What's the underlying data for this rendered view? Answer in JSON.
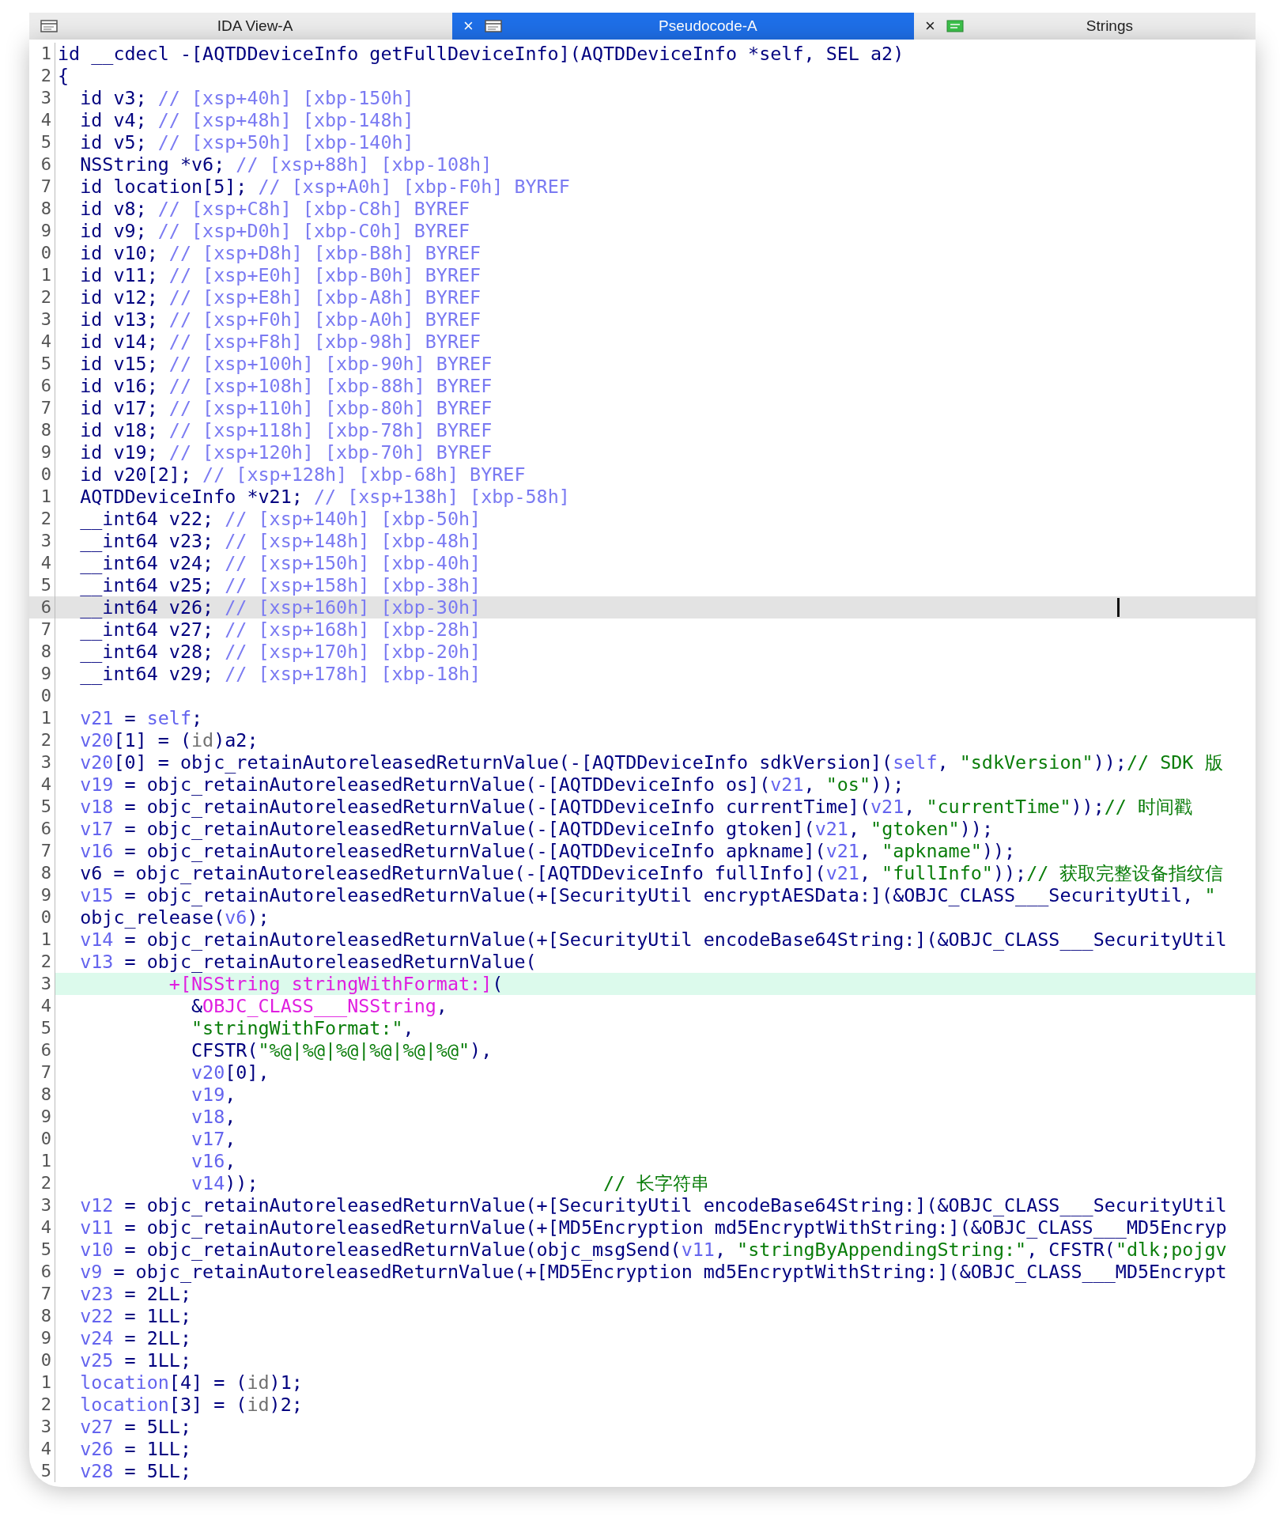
{
  "tabs": [
    {
      "label": "IDA View-A",
      "selected": false
    },
    {
      "label": "Pseudocode-A",
      "selected": true
    },
    {
      "label": "Strings",
      "selected": false
    }
  ],
  "tab_close": [
    "×",
    "×"
  ],
  "lines": [
    {
      "number": "1",
      "selected": false,
      "highlighted": false,
      "tokens": [
        {
          "kind": "plain",
          "text": "id __cdecl -[AQTDDeviceInfo getFullDeviceInfo](AQTDDeviceInfo *self, SEL a2)"
        }
      ]
    },
    {
      "number": "2",
      "selected": false,
      "highlighted": false,
      "tokens": [
        {
          "kind": "plain",
          "text": "{"
        }
      ]
    },
    {
      "number": "3",
      "selected": false,
      "highlighted": false,
      "tokens": [
        {
          "kind": "plain",
          "text": "  id v3; "
        },
        {
          "kind": "note",
          "text": "// [xsp+40h] [xbp-150h]"
        }
      ]
    },
    {
      "number": "4",
      "selected": false,
      "highlighted": false,
      "tokens": [
        {
          "kind": "plain",
          "text": "  id v4; "
        },
        {
          "kind": "note",
          "text": "// [xsp+48h] [xbp-148h]"
        }
      ]
    },
    {
      "number": "5",
      "selected": false,
      "highlighted": false,
      "tokens": [
        {
          "kind": "plain",
          "text": "  id v5; "
        },
        {
          "kind": "note",
          "text": "// [xsp+50h] [xbp-140h]"
        }
      ]
    },
    {
      "number": "6",
      "selected": false,
      "highlighted": false,
      "tokens": [
        {
          "kind": "plain",
          "text": "  NSString *v6; "
        },
        {
          "kind": "note",
          "text": "// [xsp+88h] [xbp-108h]"
        }
      ]
    },
    {
      "number": "7",
      "selected": false,
      "highlighted": false,
      "tokens": [
        {
          "kind": "plain",
          "text": "  id location[5]; "
        },
        {
          "kind": "note",
          "text": "// [xsp+A0h] [xbp-F0h] BYREF"
        }
      ]
    },
    {
      "number": "8",
      "selected": false,
      "highlighted": false,
      "tokens": [
        {
          "kind": "plain",
          "text": "  id v8; "
        },
        {
          "kind": "note",
          "text": "// [xsp+C8h] [xbp-C8h] BYREF"
        }
      ]
    },
    {
      "number": "9",
      "selected": false,
      "highlighted": false,
      "tokens": [
        {
          "kind": "plain",
          "text": "  id v9; "
        },
        {
          "kind": "note",
          "text": "// [xsp+D0h] [xbp-C0h] BYREF"
        }
      ]
    },
    {
      "number": "0",
      "selected": false,
      "highlighted": false,
      "tokens": [
        {
          "kind": "plain",
          "text": "  id v10; "
        },
        {
          "kind": "note",
          "text": "// [xsp+D8h] [xbp-B8h] BYREF"
        }
      ]
    },
    {
      "number": "1",
      "selected": false,
      "highlighted": false,
      "tokens": [
        {
          "kind": "plain",
          "text": "  id v11; "
        },
        {
          "kind": "note",
          "text": "// [xsp+E0h] [xbp-B0h] BYREF"
        }
      ]
    },
    {
      "number": "2",
      "selected": false,
      "highlighted": false,
      "tokens": [
        {
          "kind": "plain",
          "text": "  id v12; "
        },
        {
          "kind": "note",
          "text": "// [xsp+E8h] [xbp-A8h] BYREF"
        }
      ]
    },
    {
      "number": "3",
      "selected": false,
      "highlighted": false,
      "tokens": [
        {
          "kind": "plain",
          "text": "  id v13; "
        },
        {
          "kind": "note",
          "text": "// [xsp+F0h] [xbp-A0h] BYREF"
        }
      ]
    },
    {
      "number": "4",
      "selected": false,
      "highlighted": false,
      "tokens": [
        {
          "kind": "plain",
          "text": "  id v14; "
        },
        {
          "kind": "note",
          "text": "// [xsp+F8h] [xbp-98h] BYREF"
        }
      ]
    },
    {
      "number": "5",
      "selected": false,
      "highlighted": false,
      "tokens": [
        {
          "kind": "plain",
          "text": "  id v15; "
        },
        {
          "kind": "note",
          "text": "// [xsp+100h] [xbp-90h] BYREF"
        }
      ]
    },
    {
      "number": "6",
      "selected": false,
      "highlighted": false,
      "tokens": [
        {
          "kind": "plain",
          "text": "  id v16; "
        },
        {
          "kind": "note",
          "text": "// [xsp+108h] [xbp-88h] BYREF"
        }
      ]
    },
    {
      "number": "7",
      "selected": false,
      "highlighted": false,
      "tokens": [
        {
          "kind": "plain",
          "text": "  id v17; "
        },
        {
          "kind": "note",
          "text": "// [xsp+110h] [xbp-80h] BYREF"
        }
      ]
    },
    {
      "number": "8",
      "selected": false,
      "highlighted": false,
      "tokens": [
        {
          "kind": "plain",
          "text": "  id v18; "
        },
        {
          "kind": "note",
          "text": "// [xsp+118h] [xbp-78h] BYREF"
        }
      ]
    },
    {
      "number": "9",
      "selected": false,
      "highlighted": false,
      "tokens": [
        {
          "kind": "plain",
          "text": "  id v19; "
        },
        {
          "kind": "note",
          "text": "// [xsp+120h] [xbp-70h] BYREF"
        }
      ]
    },
    {
      "number": "0",
      "selected": false,
      "highlighted": false,
      "tokens": [
        {
          "kind": "plain",
          "text": "  id v20[2]; "
        },
        {
          "kind": "note",
          "text": "// [xsp+128h] [xbp-68h] BYREF"
        }
      ]
    },
    {
      "number": "1",
      "selected": false,
      "highlighted": false,
      "tokens": [
        {
          "kind": "plain",
          "text": "  AQTDDeviceInfo *v21; "
        },
        {
          "kind": "note",
          "text": "// [xsp+138h] [xbp-58h]"
        }
      ]
    },
    {
      "number": "2",
      "selected": false,
      "highlighted": false,
      "tokens": [
        {
          "kind": "plain",
          "text": "  __int64 v22; "
        },
        {
          "kind": "note",
          "text": "// [xsp+140h] [xbp-50h]"
        }
      ]
    },
    {
      "number": "3",
      "selected": false,
      "highlighted": false,
      "tokens": [
        {
          "kind": "plain",
          "text": "  __int64 v23; "
        },
        {
          "kind": "note",
          "text": "// [xsp+148h] [xbp-48h]"
        }
      ]
    },
    {
      "number": "4",
      "selected": false,
      "highlighted": false,
      "tokens": [
        {
          "kind": "plain",
          "text": "  __int64 v24; "
        },
        {
          "kind": "note",
          "text": "// [xsp+150h] [xbp-40h]"
        }
      ]
    },
    {
      "number": "5",
      "selected": false,
      "highlighted": false,
      "tokens": [
        {
          "kind": "plain",
          "text": "  __int64 v25; "
        },
        {
          "kind": "note",
          "text": "// [xsp+158h] [xbp-38h]"
        }
      ]
    },
    {
      "number": "6",
      "selected": true,
      "highlighted": false,
      "tokens": [
        {
          "kind": "plain",
          "text": "  __int64 v26; "
        },
        {
          "kind": "note",
          "text": "// [xsp+160h] [xbp-30h]"
        }
      ]
    },
    {
      "number": "7",
      "selected": false,
      "highlighted": false,
      "tokens": [
        {
          "kind": "plain",
          "text": "  __int64 v27; "
        },
        {
          "kind": "note",
          "text": "// [xsp+168h] [xbp-28h]"
        }
      ]
    },
    {
      "number": "8",
      "selected": false,
      "highlighted": false,
      "tokens": [
        {
          "kind": "plain",
          "text": "  __int64 v28; "
        },
        {
          "kind": "note",
          "text": "// [xsp+170h] [xbp-20h]"
        }
      ]
    },
    {
      "number": "9",
      "selected": false,
      "highlighted": false,
      "tokens": [
        {
          "kind": "plain",
          "text": "  __int64 v29; "
        },
        {
          "kind": "note",
          "text": "// [xsp+178h] [xbp-18h]"
        }
      ]
    },
    {
      "number": "0",
      "selected": false,
      "highlighted": false
    },
    {
      "number": "1",
      "selected": false,
      "highlighted": false,
      "tokens": [
        {
          "kind": "var",
          "text": "  v21"
        },
        {
          "kind": "plain",
          "text": " = "
        },
        {
          "kind": "var",
          "text": "self"
        },
        {
          "kind": "plain",
          "text": ";"
        }
      ]
    },
    {
      "number": "2",
      "selected": false,
      "highlighted": false,
      "tokens": [
        {
          "kind": "var",
          "text": "  v20"
        },
        {
          "kind": "plain",
          "text": "[1] = ("
        },
        {
          "kind": "cast",
          "text": "id"
        },
        {
          "kind": "plain",
          "text": ")a2;"
        }
      ]
    },
    {
      "number": "3",
      "selected": false,
      "highlighted": false,
      "tokens": [
        {
          "kind": "var",
          "text": "  v20"
        },
        {
          "kind": "plain",
          "text": "[0] = objc_retainAutoreleasedReturnValue(-[AQTDDeviceInfo sdkVersion]("
        },
        {
          "kind": "var",
          "text": "self"
        },
        {
          "kind": "plain",
          "text": ", "
        },
        {
          "kind": "str",
          "text": "\"sdkVersion\""
        },
        {
          "kind": "plain",
          "text": "));"
        },
        {
          "kind": "str",
          "text": "// SDK 版"
        }
      ]
    },
    {
      "number": "4",
      "selected": false,
      "highlighted": false,
      "tokens": [
        {
          "kind": "var",
          "text": "  v19"
        },
        {
          "kind": "plain",
          "text": " = objc_retainAutoreleasedReturnValue(-[AQTDDeviceInfo os]("
        },
        {
          "kind": "var",
          "text": "v21"
        },
        {
          "kind": "plain",
          "text": ", "
        },
        {
          "kind": "str",
          "text": "\"os\""
        },
        {
          "kind": "plain",
          "text": "));"
        }
      ]
    },
    {
      "number": "5",
      "selected": false,
      "highlighted": false,
      "tokens": [
        {
          "kind": "var",
          "text": "  v18"
        },
        {
          "kind": "plain",
          "text": " = objc_retainAutoreleasedReturnValue(-[AQTDDeviceInfo currentTime]("
        },
        {
          "kind": "var",
          "text": "v21"
        },
        {
          "kind": "plain",
          "text": ", "
        },
        {
          "kind": "str",
          "text": "\"currentTime\""
        },
        {
          "kind": "plain",
          "text": "));"
        },
        {
          "kind": "str",
          "text": "// 时间戳"
        }
      ]
    },
    {
      "number": "6",
      "selected": false,
      "highlighted": false,
      "tokens": [
        {
          "kind": "var",
          "text": "  v17"
        },
        {
          "kind": "plain",
          "text": " = objc_retainAutoreleasedReturnValue(-[AQTDDeviceInfo gtoken]("
        },
        {
          "kind": "var",
          "text": "v21"
        },
        {
          "kind": "plain",
          "text": ", "
        },
        {
          "kind": "str",
          "text": "\"gtoken\""
        },
        {
          "kind": "plain",
          "text": "));"
        }
      ]
    },
    {
      "number": "7",
      "selected": false,
      "highlighted": false,
      "tokens": [
        {
          "kind": "var",
          "text": "  v16"
        },
        {
          "kind": "plain",
          "text": " = objc_retainAutoreleasedReturnValue(-[AQTDDeviceInfo apkname]("
        },
        {
          "kind": "var",
          "text": "v21"
        },
        {
          "kind": "plain",
          "text": ", "
        },
        {
          "kind": "str",
          "text": "\"apkname\""
        },
        {
          "kind": "plain",
          "text": "));"
        }
      ]
    },
    {
      "number": "8",
      "selected": false,
      "highlighted": false,
      "tokens": [
        {
          "kind": "plain",
          "text": "  v6 = objc_retainAutoreleasedReturnValue(-[AQTDDeviceInfo fullInfo]("
        },
        {
          "kind": "var",
          "text": "v21"
        },
        {
          "kind": "plain",
          "text": ", "
        },
        {
          "kind": "str",
          "text": "\"fullInfo\""
        },
        {
          "kind": "plain",
          "text": "));"
        },
        {
          "kind": "str",
          "text": "// 获取完整设备指纹信"
        }
      ]
    },
    {
      "number": "9",
      "selected": false,
      "highlighted": false,
      "tokens": [
        {
          "kind": "var",
          "text": "  v15"
        },
        {
          "kind": "plain",
          "text": " = objc_retainAutoreleasedReturnValue(+[SecurityUtil encryptAESData:](&OBJC_CLASS___SecurityUtil, "
        },
        {
          "kind": "str",
          "text": "\""
        }
      ]
    },
    {
      "number": "0",
      "selected": false,
      "highlighted": false,
      "tokens": [
        {
          "kind": "plain",
          "text": "  objc_release("
        },
        {
          "kind": "var",
          "text": "v6"
        },
        {
          "kind": "plain",
          "text": ");"
        }
      ]
    },
    {
      "number": "1",
      "selected": false,
      "highlighted": false,
      "tokens": [
        {
          "kind": "var",
          "text": "  v14"
        },
        {
          "kind": "plain",
          "text": " = objc_retainAutoreleasedReturnValue(+[SecurityUtil encodeBase64String:](&OBJC_CLASS___SecurityUtil"
        }
      ]
    },
    {
      "number": "2",
      "selected": false,
      "highlighted": false,
      "tokens": [
        {
          "kind": "var",
          "text": "  v13"
        },
        {
          "kind": "plain",
          "text": " = objc_retainAutoreleasedReturnValue("
        }
      ]
    },
    {
      "number": "3",
      "selected": false,
      "highlighted": true,
      "tokens": [
        {
          "kind": "cls",
          "text": "          +[NSString stringWithFormat:]"
        },
        {
          "kind": "plain",
          "text": "("
        }
      ]
    },
    {
      "number": "4",
      "selected": false,
      "highlighted": false,
      "tokens": [
        {
          "kind": "plain",
          "text": "            &"
        },
        {
          "kind": "cls",
          "text": "OBJC_CLASS___NSString"
        },
        {
          "kind": "plain",
          "text": ","
        }
      ]
    },
    {
      "number": "5",
      "selected": false,
      "highlighted": false,
      "tokens": [
        {
          "kind": "str",
          "text": "            \"stringWithFormat:\""
        },
        {
          "kind": "plain",
          "text": ","
        }
      ]
    },
    {
      "number": "6",
      "selected": false,
      "highlighted": false,
      "tokens": [
        {
          "kind": "plain",
          "text": "            CFSTR("
        },
        {
          "kind": "str",
          "text": "\"%@|%@|%@|%@|%@|%@\""
        },
        {
          "kind": "plain",
          "text": "),"
        }
      ]
    },
    {
      "number": "7",
      "selected": false,
      "highlighted": false,
      "tokens": [
        {
          "kind": "var",
          "text": "            v20"
        },
        {
          "kind": "plain",
          "text": "[0],"
        }
      ]
    },
    {
      "number": "8",
      "selected": false,
      "highlighted": false,
      "tokens": [
        {
          "kind": "var",
          "text": "            v19"
        },
        {
          "kind": "plain",
          "text": ","
        }
      ]
    },
    {
      "number": "9",
      "selected": false,
      "highlighted": false,
      "tokens": [
        {
          "kind": "var",
          "text": "            v18"
        },
        {
          "kind": "plain",
          "text": ","
        }
      ]
    },
    {
      "number": "0",
      "selected": false,
      "highlighted": false,
      "tokens": [
        {
          "kind": "var",
          "text": "            v17"
        },
        {
          "kind": "plain",
          "text": ","
        }
      ]
    },
    {
      "number": "1",
      "selected": false,
      "highlighted": false,
      "tokens": [
        {
          "kind": "var",
          "text": "            v16"
        },
        {
          "kind": "plain",
          "text": ","
        }
      ]
    },
    {
      "number": "2",
      "selected": false,
      "highlighted": false,
      "tokens": [
        {
          "kind": "var",
          "text": "            v14"
        },
        {
          "kind": "plain",
          "text": "));                               "
        },
        {
          "kind": "str",
          "text": "// 长字符串"
        }
      ]
    },
    {
      "number": "3",
      "selected": false,
      "highlighted": false,
      "tokens": [
        {
          "kind": "var",
          "text": "  v12"
        },
        {
          "kind": "plain",
          "text": " = objc_retainAutoreleasedReturnValue(+[SecurityUtil encodeBase64String:](&OBJC_CLASS___SecurityUtil"
        }
      ]
    },
    {
      "number": "4",
      "selected": false,
      "highlighted": false,
      "tokens": [
        {
          "kind": "var",
          "text": "  v11"
        },
        {
          "kind": "plain",
          "text": " = objc_retainAutoreleasedReturnValue(+[MD5Encryption md5EncryptWithString:](&OBJC_CLASS___MD5Encryp"
        }
      ]
    },
    {
      "number": "5",
      "selected": false,
      "highlighted": false,
      "tokens": [
        {
          "kind": "var",
          "text": "  v10"
        },
        {
          "kind": "plain",
          "text": " = objc_retainAutoreleasedReturnValue(objc_msgSend("
        },
        {
          "kind": "var",
          "text": "v11"
        },
        {
          "kind": "plain",
          "text": ", "
        },
        {
          "kind": "str",
          "text": "\"stringByAppendingString:\""
        },
        {
          "kind": "plain",
          "text": ", CFSTR("
        },
        {
          "kind": "str",
          "text": "\"dlk;pojgv"
        }
      ]
    },
    {
      "number": "6",
      "selected": false,
      "highlighted": false,
      "tokens": [
        {
          "kind": "var",
          "text": "  v9"
        },
        {
          "kind": "plain",
          "text": " = objc_retainAutoreleasedReturnValue(+[MD5Encryption md5EncryptWithString:](&OBJC_CLASS___MD5Encrypt"
        }
      ]
    },
    {
      "number": "7",
      "selected": false,
      "highlighted": false,
      "tokens": [
        {
          "kind": "var",
          "text": "  v23"
        },
        {
          "kind": "plain",
          "text": " = 2LL;"
        }
      ]
    },
    {
      "number": "8",
      "selected": false,
      "highlighted": false,
      "tokens": [
        {
          "kind": "var",
          "text": "  v22"
        },
        {
          "kind": "plain",
          "text": " = 1LL;"
        }
      ]
    },
    {
      "number": "9",
      "selected": false,
      "highlighted": false,
      "tokens": [
        {
          "kind": "var",
          "text": "  v24"
        },
        {
          "kind": "plain",
          "text": " = 2LL;"
        }
      ]
    },
    {
      "number": "0",
      "selected": false,
      "highlighted": false,
      "tokens": [
        {
          "kind": "var",
          "text": "  v25"
        },
        {
          "kind": "plain",
          "text": " = 1LL;"
        }
      ]
    },
    {
      "number": "1",
      "selected": false,
      "highlighted": false,
      "tokens": [
        {
          "kind": "var",
          "text": "  location"
        },
        {
          "kind": "plain",
          "text": "[4] = ("
        },
        {
          "kind": "cast",
          "text": "id"
        },
        {
          "kind": "plain",
          "text": ")1;"
        }
      ]
    },
    {
      "number": "2",
      "selected": false,
      "highlighted": false,
      "tokens": [
        {
          "kind": "var",
          "text": "  location"
        },
        {
          "kind": "plain",
          "text": "[3] = ("
        },
        {
          "kind": "cast",
          "text": "id"
        },
        {
          "kind": "plain",
          "text": ")2;"
        }
      ]
    },
    {
      "number": "3",
      "selected": false,
      "highlighted": false,
      "tokens": [
        {
          "kind": "var",
          "text": "  v27"
        },
        {
          "kind": "plain",
          "text": " = 5LL;"
        }
      ]
    },
    {
      "number": "4",
      "selected": false,
      "highlighted": false,
      "tokens": [
        {
          "kind": "var",
          "text": "  v26"
        },
        {
          "kind": "plain",
          "text": " = 1LL;"
        }
      ]
    },
    {
      "number": "5",
      "selected": false,
      "highlighted": false,
      "tokens": [
        {
          "kind": "var",
          "text": "  v28"
        },
        {
          "kind": "plain",
          "text": " = 5LL;"
        }
      ]
    }
  ]
}
